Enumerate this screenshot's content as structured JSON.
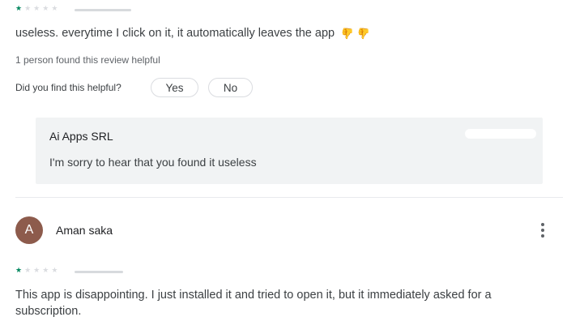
{
  "review1": {
    "rating": 1,
    "text": "useless. everytime I click on it, it automatically leaves the app",
    "emoji": "👍👍",
    "helpful_count": "1 person found this review helpful",
    "helpful_question": "Did you find this helpful?",
    "yes_label": "Yes",
    "no_label": "No",
    "developer_reply": {
      "name": "Ai Apps SRL",
      "text": "I'm sorry to hear that you found it useless"
    }
  },
  "review2": {
    "avatar_letter": "A",
    "author": "Aman saka",
    "rating": 1,
    "text": "This app is disappointing. I just installed it and tried to open it, but it immediately asked for a subscription."
  },
  "icons": {
    "star": "star-icon",
    "thumb": "thumbs-down-icon",
    "more": "more-vert-icon"
  },
  "colors": {
    "star_filled": "#01875f",
    "avatar_bg": "#8d5b4c",
    "reply_bg": "#f1f3f4"
  }
}
